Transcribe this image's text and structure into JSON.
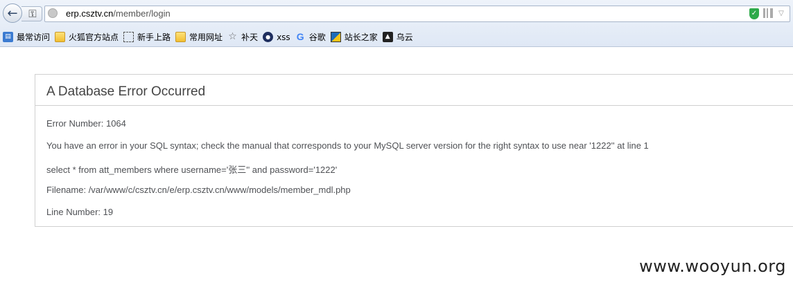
{
  "browser": {
    "url_host": "erp.csztv.cn",
    "url_path": "/member/login",
    "icons": {
      "back": "back-arrow-icon",
      "identity": "key-icon",
      "site": "globe-icon",
      "security": "shield-icon",
      "qrcode": "qr-code-icon",
      "dropdown": "chevron-down-icon"
    }
  },
  "bookmarks": [
    {
      "label": "最常访问",
      "icon": "most-visited-icon"
    },
    {
      "label": "火狐官方站点",
      "icon": "folder-icon"
    },
    {
      "label": "新手上路",
      "icon": "dashed-page-icon"
    },
    {
      "label": "常用网址",
      "icon": "folder-icon"
    },
    {
      "label": "补天",
      "icon": "star-icon"
    },
    {
      "label": "xss",
      "icon": "seal-icon"
    },
    {
      "label": "谷歌",
      "icon": "google-icon"
    },
    {
      "label": "站长之家",
      "icon": "zz-icon"
    },
    {
      "label": "乌云",
      "icon": "wooyun-icon"
    }
  ],
  "error": {
    "heading": "A Database Error Occurred",
    "lines": [
      "Error Number: 1064",
      "You have an error in your SQL syntax; check the manual that corresponds to your MySQL server version for the right syntax to use near '1222'' at line 1",
      "select * from att_members where username='张三'' and password='1222'",
      "Filename: /var/www/c/csztv.cn/e/erp.csztv.cn/www/models/member_mdl.php",
      "Line Number: 19"
    ]
  },
  "watermark": "www.wooyun.org"
}
